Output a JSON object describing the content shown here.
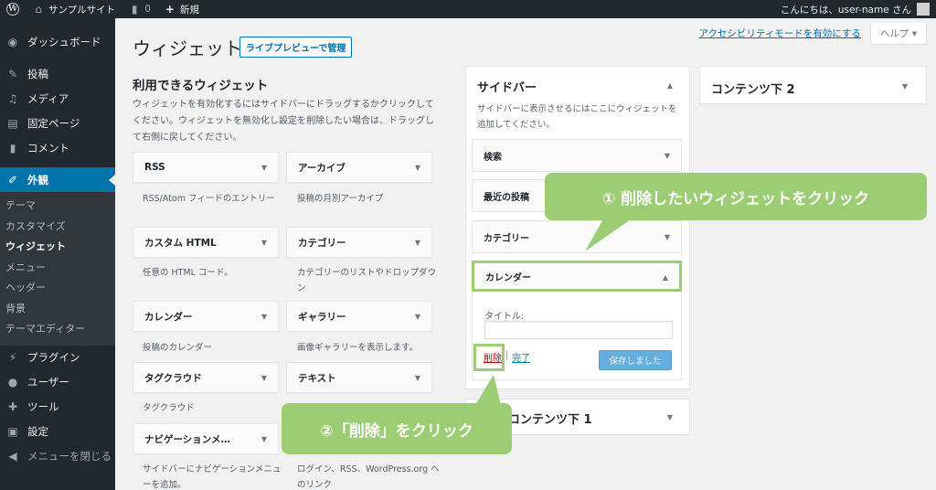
{
  "admin_bar": {
    "site_name": "サンプルサイト",
    "comment_count": "0",
    "new_label": "新規",
    "greeting": "こんにちは、user-name さん"
  },
  "menu": {
    "dashboard": "ダッシュボード",
    "posts": "投稿",
    "media": "メディア",
    "pages": "固定ページ",
    "comments": "コメント",
    "appearance": "外観",
    "appearance_sub": [
      "テーマ",
      "カスタマイズ",
      "ウィジェット",
      "メニュー",
      "ヘッダー",
      "背景",
      "テーマエディター"
    ],
    "plugins": "プラグイン",
    "users": "ユーザー",
    "tools": "ツール",
    "settings": "設定",
    "collapse": "メニューを閉じる"
  },
  "screen_meta": {
    "a11y_link": "アクセシビリティモードを有効にする",
    "help_label": "ヘルプ ▾"
  },
  "page": {
    "title": "ウィジェット",
    "live_preview_button": "ライブプレビューで管理",
    "available_title": "利用できるウィジェット",
    "available_desc": "ウィジェットを有効化するにはサイドバーにドラッグするかクリックしてください。ウィジェットを無効化し設定を削除したい場合は、ドラッグして右側に戻してください。"
  },
  "widgets": [
    {
      "name": "RSS",
      "desc": "RSS/Atom フィードのエントリー"
    },
    {
      "name": "アーカイブ",
      "desc": "投稿の月別アーカイブ"
    },
    {
      "name": "カスタム HTML",
      "desc": "任意の HTML コード。"
    },
    {
      "name": "カテゴリー",
      "desc": "カテゴリーのリストやドロップダウン"
    },
    {
      "name": "カレンダー",
      "desc": "投稿のカレンダー"
    },
    {
      "name": "ギャラリー",
      "desc": "画像ギャラリーを表示します。"
    },
    {
      "name": "タグクラウド",
      "desc": "タグクラウド"
    },
    {
      "name": "テキスト",
      "desc": ""
    },
    {
      "name": "ナビゲーションメ…",
      "desc": "サイドバーにナビゲーションメニューを追加。"
    },
    {
      "name": "",
      "desc": "ログイン、RSS、WordPress.org へのリンク"
    }
  ],
  "sidebar_area": {
    "title": "サイドバー",
    "desc": "サイドバーに表示させるにはここにウィジェットを追加してください。",
    "widgets": [
      "検索",
      "最近の投稿",
      "カテゴリー",
      "カレンダー"
    ],
    "open_widget": {
      "field_label": "タイトル:",
      "title_value": "",
      "delete_link": "削除",
      "separator": "|",
      "done_link": "完了",
      "save_button": "保存しました"
    }
  },
  "other_areas": {
    "content_bottom_1": "コンテンツ下 1",
    "content_bottom_2": "コンテンツ下 2"
  },
  "callouts": {
    "step1": "① 削除したいウィジェットをクリック",
    "step2": "②「削除」をクリック"
  },
  "colors": {
    "admin_bg": "#23282d",
    "active_menu": "#0073aa",
    "highlight": "#9ccc74",
    "save_button": "#66aedd"
  }
}
